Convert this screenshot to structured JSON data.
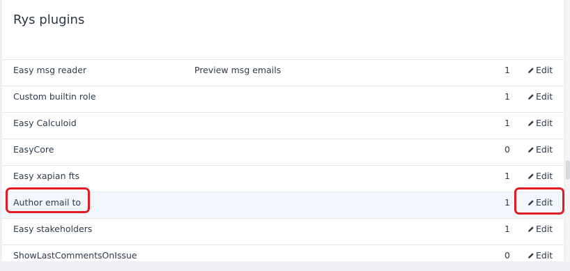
{
  "page": {
    "title": "Rys plugins"
  },
  "plugins": [
    {
      "name": "Easy msg reader",
      "description": "Preview msg emails",
      "count": "1",
      "edit_label": "Edit"
    },
    {
      "name": "Custom builtin role",
      "description": "",
      "count": "1",
      "edit_label": "Edit"
    },
    {
      "name": "Easy Calculoid",
      "description": "",
      "count": "1",
      "edit_label": "Edit"
    },
    {
      "name": "EasyCore",
      "description": "",
      "count": "0",
      "edit_label": "Edit"
    },
    {
      "name": "Easy xapian fts",
      "description": "",
      "count": "1",
      "edit_label": "Edit"
    },
    {
      "name": "Author email to",
      "description": "",
      "count": "1",
      "edit_label": "Edit"
    },
    {
      "name": "Easy stakeholders",
      "description": "",
      "count": "1",
      "edit_label": "Edit"
    },
    {
      "name": "ShowLastCommentsOnIssue",
      "description": "",
      "count": "0",
      "edit_label": "Edit"
    }
  ],
  "icons": {
    "edit": "pencil-icon"
  },
  "colors": {
    "highlight_row": "#f2f7fd",
    "callout_border": "#e11b22",
    "text": "#2f3b4a"
  },
  "highlighted_row_index": 5
}
